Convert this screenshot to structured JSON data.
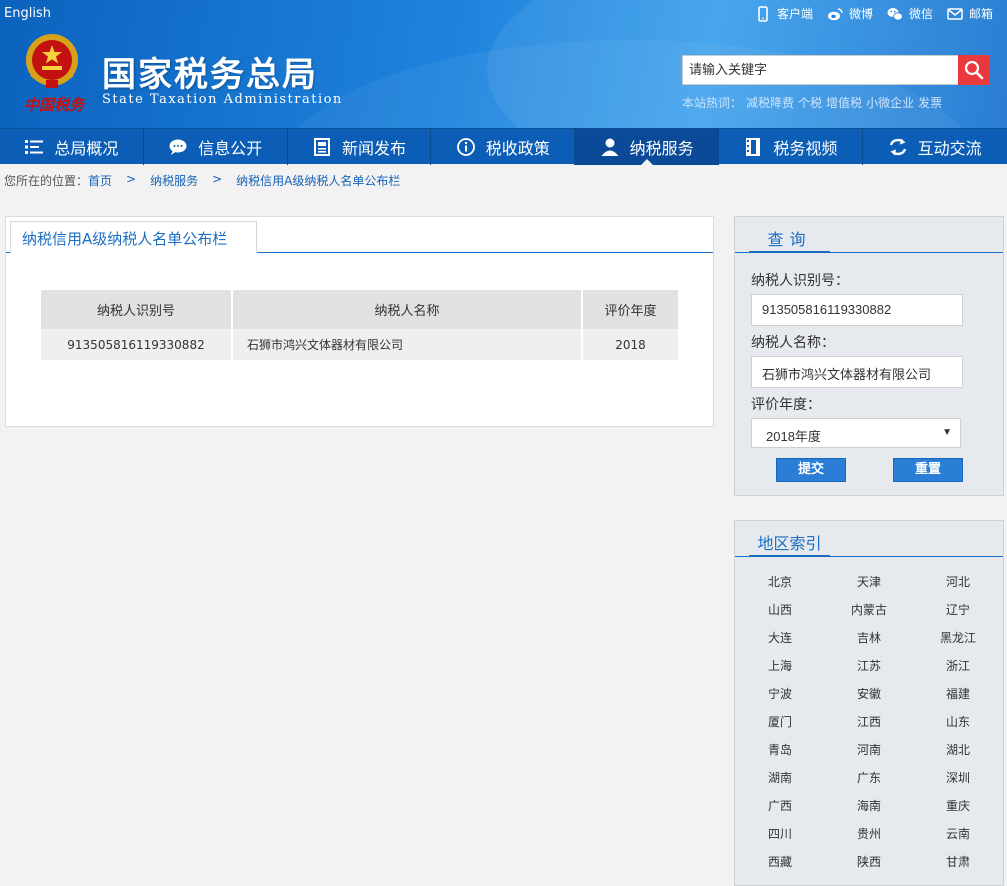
{
  "header": {
    "english_link": "English",
    "top_links": [
      {
        "label": "客户端",
        "icon": "mobile-icon"
      },
      {
        "label": "微博",
        "icon": "weibo-icon"
      },
      {
        "label": "微信",
        "icon": "wechat-icon"
      },
      {
        "label": "邮箱",
        "icon": "mail-icon"
      }
    ],
    "logo_calligraphy": "中国税务",
    "title_cn": "国家税务总局",
    "title_en": "State Taxation Administration",
    "search": {
      "placeholder": "请输入关键字"
    },
    "hot_words_label": "本站热词：",
    "hot_words": [
      "减税降费",
      "个税",
      "增值税",
      "小微企业",
      "发票"
    ]
  },
  "nav": {
    "items": [
      {
        "label": "总局概况",
        "icon": "menu-list-icon"
      },
      {
        "label": "信息公开",
        "icon": "speech-bubble-icon"
      },
      {
        "label": "新闻发布",
        "icon": "newspaper-icon"
      },
      {
        "label": "税收政策",
        "icon": "info-circle-icon"
      },
      {
        "label": "纳税服务",
        "icon": "user-icon",
        "active": true
      },
      {
        "label": "税务视频",
        "icon": "film-icon"
      },
      {
        "label": "互动交流",
        "icon": "refresh-arrows-icon"
      }
    ]
  },
  "breadcrumb": {
    "prefix": "您所在的位置：",
    "items": [
      "首页",
      "纳税服务",
      "纳税信用A级纳税人名单公布栏"
    ],
    "separator": ">"
  },
  "main": {
    "tab_label": "纳税信用A级纳税人名单公布栏",
    "table": {
      "headers": [
        "纳税人识别号",
        "纳税人名称",
        "评价年度"
      ],
      "rows": [
        [
          "913505816119330882",
          "石狮市鸿兴文体器材有限公司",
          "2018"
        ]
      ]
    }
  },
  "query": {
    "title": "查询",
    "taxpayer_id_label": "纳税人识别号：",
    "taxpayer_id_value": "913505816119330882",
    "taxpayer_name_label": "纳税人名称：",
    "taxpayer_name_value": "石狮市鸿兴文体器材有限公司",
    "year_label": "评价年度：",
    "year_selected": "2018年度",
    "submit_label": "提交",
    "reset_label": "重置"
  },
  "region_index": {
    "title": "地区索引",
    "regions": [
      "北京",
      "天津",
      "河北",
      "山西",
      "内蒙古",
      "辽宁",
      "大连",
      "吉林",
      "黑龙江",
      "上海",
      "江苏",
      "浙江",
      "宁波",
      "安徽",
      "福建",
      "厦门",
      "江西",
      "山东",
      "青岛",
      "河南",
      "湖北",
      "湖南",
      "广东",
      "深圳",
      "广西",
      "海南",
      "重庆",
      "四川",
      "贵州",
      "云南",
      "西藏",
      "陕西",
      "甘肃"
    ]
  },
  "colors": {
    "nav_bg": "#0c5db5",
    "accent_blue": "#1a6fc4",
    "search_button": "#e9393d",
    "logo_red": "#c31111"
  }
}
